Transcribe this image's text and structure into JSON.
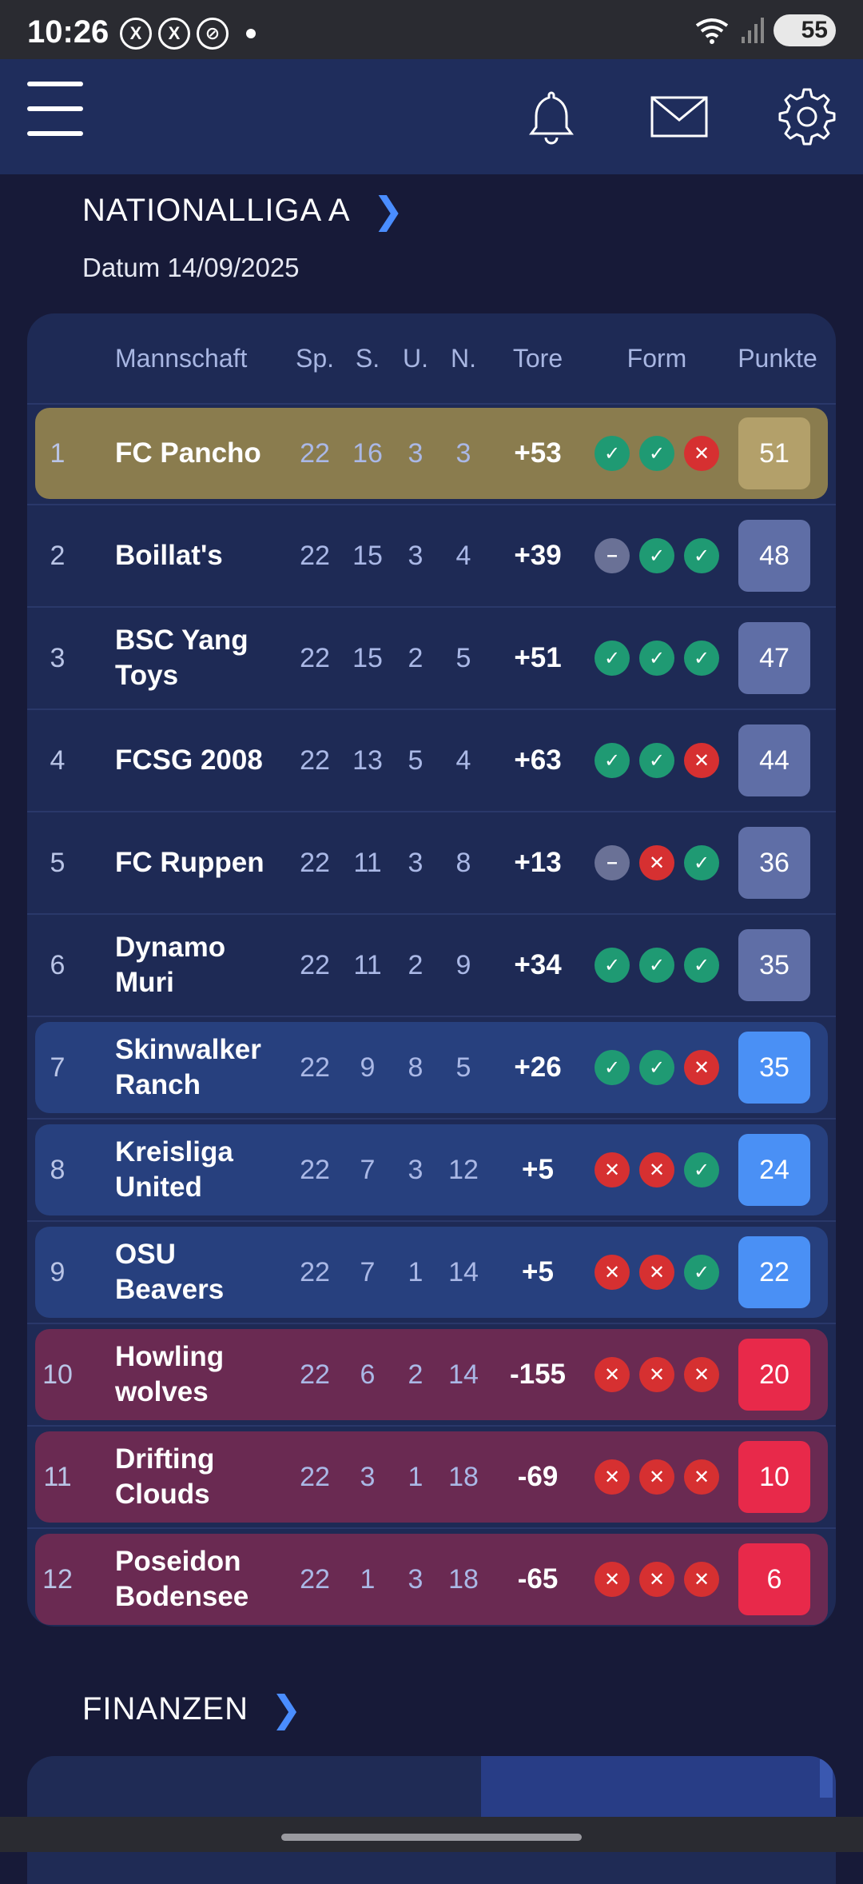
{
  "status": {
    "time": "10:26",
    "battery": "55"
  },
  "header": {
    "menu_icon": "hamburger-menu-icon",
    "icons": [
      "bell-icon",
      "mail-icon",
      "gear-icon"
    ]
  },
  "league": {
    "title": "NATIONALLIGA A",
    "date": "Datum 14/09/2025"
  },
  "table": {
    "headers": {
      "team": "Mannschaft",
      "played": "Sp.",
      "won": "S.",
      "drawn": "U.",
      "lost": "N.",
      "goals": "Tore",
      "form": "Form",
      "points": "Punkte"
    },
    "rows": [
      {
        "rank": "1",
        "team": "FC Pancho",
        "sp": "22",
        "s": "16",
        "u": "3",
        "n": "3",
        "tore": "+53",
        "form": [
          "W",
          "W",
          "L"
        ],
        "pts": "51",
        "zone": "champion"
      },
      {
        "rank": "2",
        "team": "Boillat's",
        "sp": "22",
        "s": "15",
        "u": "3",
        "n": "4",
        "tore": "+39",
        "form": [
          "D",
          "W",
          "W"
        ],
        "pts": "48",
        "zone": "normal"
      },
      {
        "rank": "3",
        "team": "BSC Yang Toys",
        "sp": "22",
        "s": "15",
        "u": "2",
        "n": "5",
        "tore": "+51",
        "form": [
          "W",
          "W",
          "W"
        ],
        "pts": "47",
        "zone": "normal"
      },
      {
        "rank": "4",
        "team": "FCSG 2008",
        "sp": "22",
        "s": "13",
        "u": "5",
        "n": "4",
        "tore": "+63",
        "form": [
          "W",
          "W",
          "L"
        ],
        "pts": "44",
        "zone": "normal"
      },
      {
        "rank": "5",
        "team": "FC Ruppen",
        "sp": "22",
        "s": "11",
        "u": "3",
        "n": "8",
        "tore": "+13",
        "form": [
          "D",
          "L",
          "W"
        ],
        "pts": "36",
        "zone": "normal"
      },
      {
        "rank": "6",
        "team": "Dynamo Muri",
        "sp": "22",
        "s": "11",
        "u": "2",
        "n": "9",
        "tore": "+34",
        "form": [
          "W",
          "W",
          "W"
        ],
        "pts": "35",
        "zone": "normal"
      },
      {
        "rank": "7",
        "team": "Skinwalker Ranch",
        "sp": "22",
        "s": "9",
        "u": "8",
        "n": "5",
        "tore": "+26",
        "form": [
          "W",
          "W",
          "L"
        ],
        "pts": "35",
        "zone": "mid"
      },
      {
        "rank": "8",
        "team": "Kreisliga United",
        "sp": "22",
        "s": "7",
        "u": "3",
        "n": "12",
        "tore": "+5",
        "form": [
          "L",
          "L",
          "W"
        ],
        "pts": "24",
        "zone": "mid"
      },
      {
        "rank": "9",
        "team": "OSU Beavers",
        "sp": "22",
        "s": "7",
        "u": "1",
        "n": "14",
        "tore": "+5",
        "form": [
          "L",
          "L",
          "W"
        ],
        "pts": "22",
        "zone": "mid"
      },
      {
        "rank": "10",
        "team": "Howling wolves",
        "sp": "22",
        "s": "6",
        "u": "2",
        "n": "14",
        "tore": "-155",
        "form": [
          "L",
          "L",
          "L"
        ],
        "pts": "20",
        "zone": "relegation"
      },
      {
        "rank": "11",
        "team": "Drifting Clouds",
        "sp": "22",
        "s": "3",
        "u": "1",
        "n": "18",
        "tore": "-69",
        "form": [
          "L",
          "L",
          "L"
        ],
        "pts": "10",
        "zone": "relegation"
      },
      {
        "rank": "12",
        "team": "Poseidon Bodensee",
        "sp": "22",
        "s": "1",
        "u": "3",
        "n": "18",
        "tore": "-65",
        "form": [
          "L",
          "L",
          "L"
        ],
        "pts": "6",
        "zone": "relegation"
      }
    ]
  },
  "finances": {
    "title": "FINANZEN"
  },
  "colors": {
    "champion_row": "#8a7c4e",
    "champion_pts": "#b3a06a",
    "normal_pts": "#5f6ea6",
    "mid_row": "#27407e",
    "mid_pts": "#4a90f5",
    "relegation_row": "#6a2a52",
    "relegation_pts": "#e8294a",
    "win": "#1f9a73",
    "loss": "#d63031",
    "draw": "#6a7196"
  }
}
